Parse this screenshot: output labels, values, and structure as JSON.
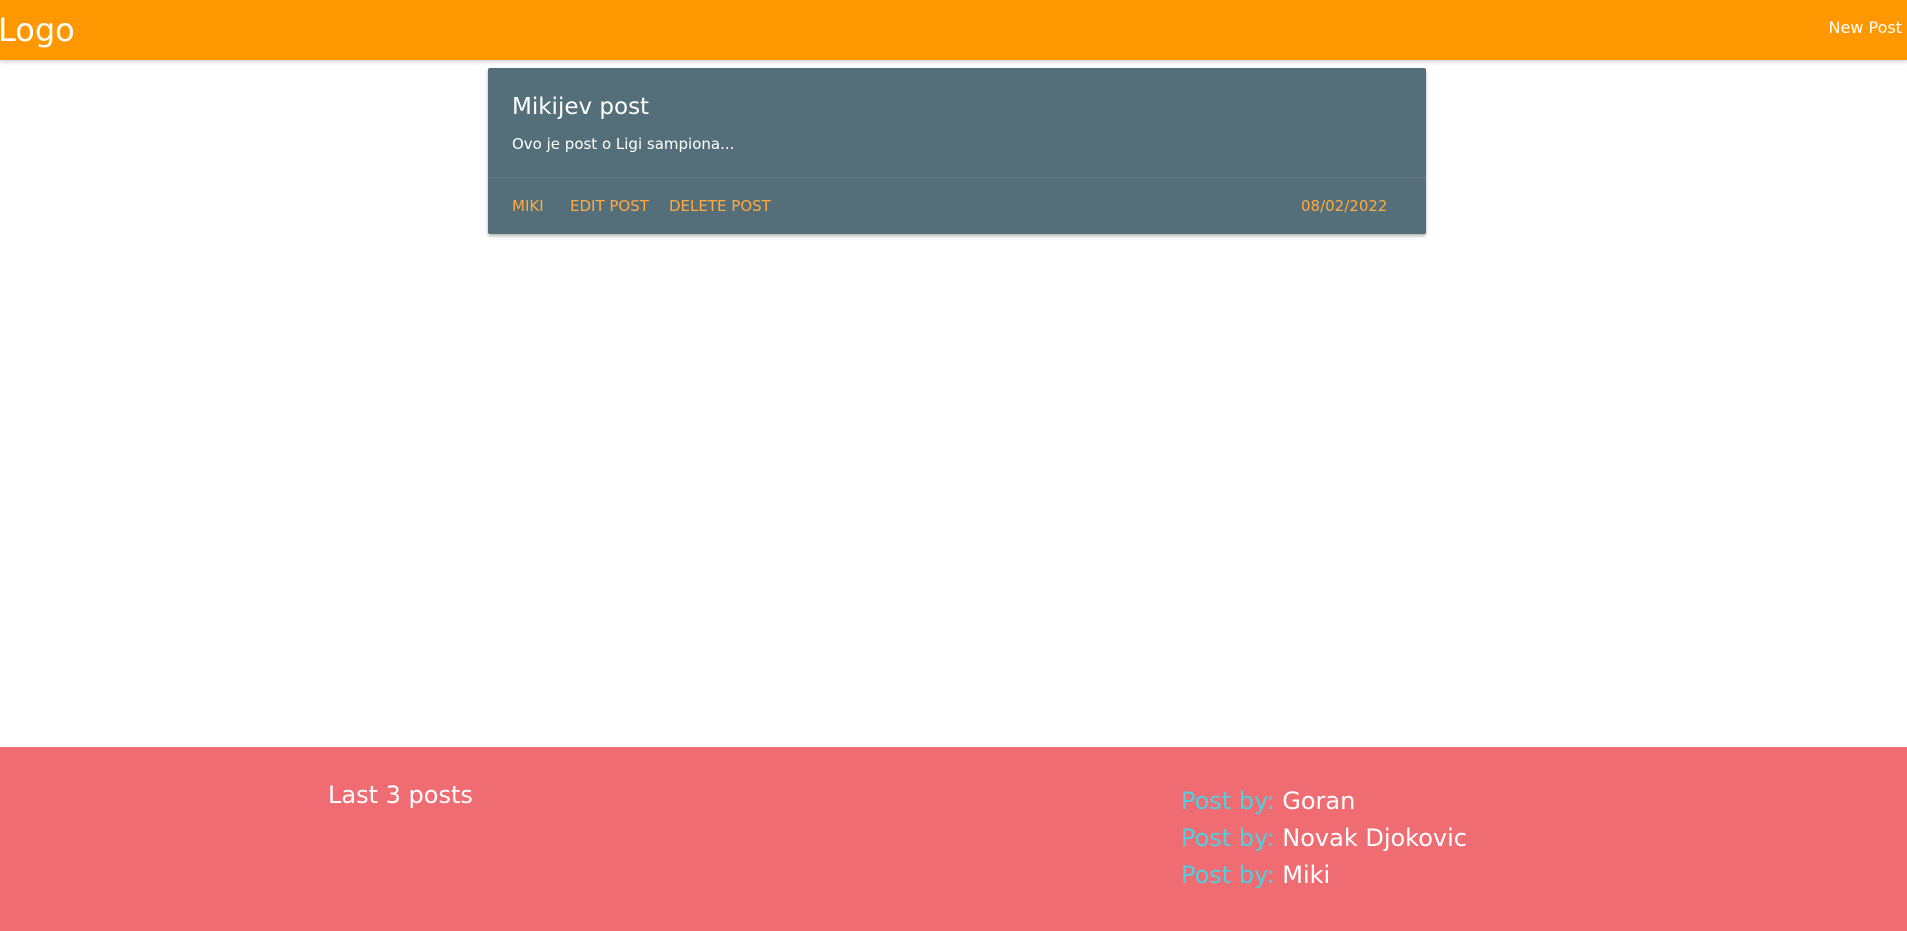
{
  "navbar": {
    "logo": "Logo",
    "new_post_label": "New Post",
    "background_color": "#ff9800"
  },
  "post": {
    "title": "Mikijev post",
    "excerpt": "Ovo je post o Ligi sampiona...",
    "author": "MIKI",
    "edit_label": "EDIT POST",
    "delete_label": "DELETE POST",
    "date": "08/02/2022",
    "card_color": "#546e7a",
    "action_color": "#ffab40"
  },
  "footer": {
    "title": "Last 3 posts",
    "background_color": "#ef6c73",
    "prefix_color": "#4dd0e1",
    "recent_posts": [
      {
        "prefix": "Post by:",
        "author": "Goran"
      },
      {
        "prefix": "Post by:",
        "author": "Novak Djokovic"
      },
      {
        "prefix": "Post by:",
        "author": "Miki"
      }
    ]
  }
}
